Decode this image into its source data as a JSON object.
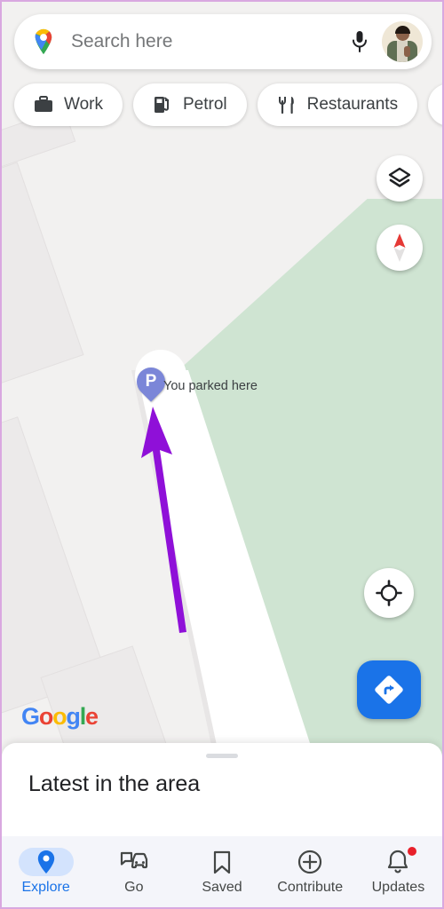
{
  "app": {
    "name": "Google Maps",
    "watermark_letters": [
      "G",
      "o",
      "o",
      "g",
      "l",
      "e"
    ]
  },
  "search": {
    "placeholder": "Search here",
    "value": "",
    "logo_icon": "google-maps-pin-icon",
    "mic_icon": "microphone-icon",
    "avatar_icon": "profile-avatar"
  },
  "chips": [
    {
      "label": "Work",
      "icon": "briefcase-icon"
    },
    {
      "label": "Petrol",
      "icon": "fuel-pump-icon"
    },
    {
      "label": "Restaurants",
      "icon": "fork-knife-icon"
    },
    {
      "label": "",
      "icon": "hotel-bed-icon"
    }
  ],
  "map_controls": {
    "layers": {
      "name": "Layers",
      "icon": "layers-icon"
    },
    "compass": {
      "name": "Compass",
      "icon": "compass-needle-icon"
    },
    "locate": {
      "name": "Your location",
      "icon": "my-location-crosshair-icon"
    },
    "directions": {
      "name": "Directions",
      "icon": "directions-arrow-icon",
      "color": "#1a73e8"
    }
  },
  "map": {
    "parking_marker": {
      "letter": "P",
      "label": "You parked here",
      "pin_color": "#7b86d8",
      "label_color": "#3c4043"
    },
    "annotation_arrow": {
      "color": "#8f10d8",
      "direction": "up"
    },
    "colors": {
      "land": "#f2f1f0",
      "park": "#cfe4d2",
      "road": "#ffffff",
      "building": "#eceaea"
    }
  },
  "bottom_sheet": {
    "title": "Latest in the area",
    "handle": "drag-handle"
  },
  "bottom_nav": {
    "items": [
      {
        "label": "Explore",
        "icon": "map-pin-icon",
        "active": true,
        "badge": false
      },
      {
        "label": "Go",
        "icon": "commute-car-icon",
        "active": false,
        "badge": false
      },
      {
        "label": "Saved",
        "icon": "bookmark-icon",
        "active": false,
        "badge": false
      },
      {
        "label": "Contribute",
        "icon": "plus-circle-icon",
        "active": false,
        "badge": false
      },
      {
        "label": "Updates",
        "icon": "bell-icon",
        "active": false,
        "badge": true
      }
    ],
    "active_color": "#1a73e8",
    "badge_color": "#e8202a"
  }
}
